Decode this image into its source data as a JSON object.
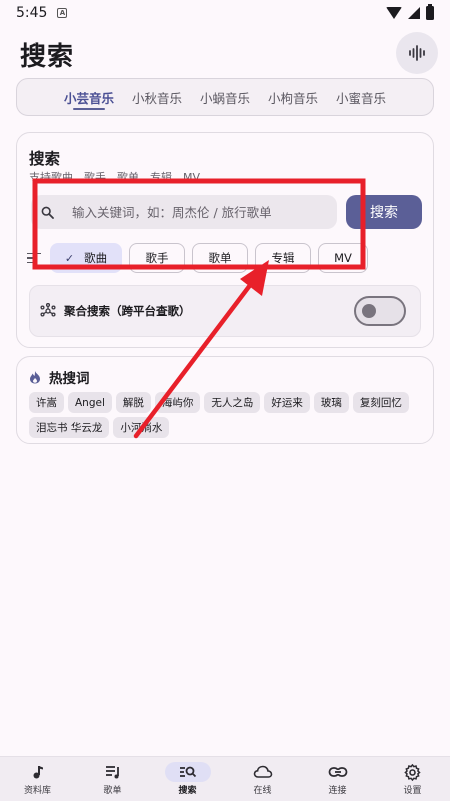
{
  "status": {
    "time": "5:45"
  },
  "page": {
    "title": "搜索"
  },
  "source_tabs": [
    "小芸音乐",
    "小秋音乐",
    "小蜗音乐",
    "小枸音乐",
    "小蜜音乐"
  ],
  "search": {
    "card_title": "搜索",
    "support_text": "支持歌曲、歌手、歌单、专辑、MV",
    "placeholder": "输入关键词，如：周杰伦 / 旅行歌单",
    "button": "搜索"
  },
  "filters": [
    "歌曲",
    "歌手",
    "歌单",
    "专辑",
    "MV"
  ],
  "aggregate": {
    "label": "聚合搜索（跨平台查歌）",
    "enabled": false
  },
  "hot": {
    "title": "热搜词",
    "tags": [
      "许嵩",
      "Angel",
      "解脱",
      "海屿你",
      "无人之岛",
      "好运来",
      "玻璃",
      "复刻回忆",
      "泪忘书 华云龙",
      "小河淌水"
    ]
  },
  "nav": [
    "资料库",
    "歌单",
    "搜索",
    "在线",
    "连接",
    "设置"
  ],
  "colors": {
    "accent": "#5b5f97",
    "annotation": "#e8202a"
  }
}
